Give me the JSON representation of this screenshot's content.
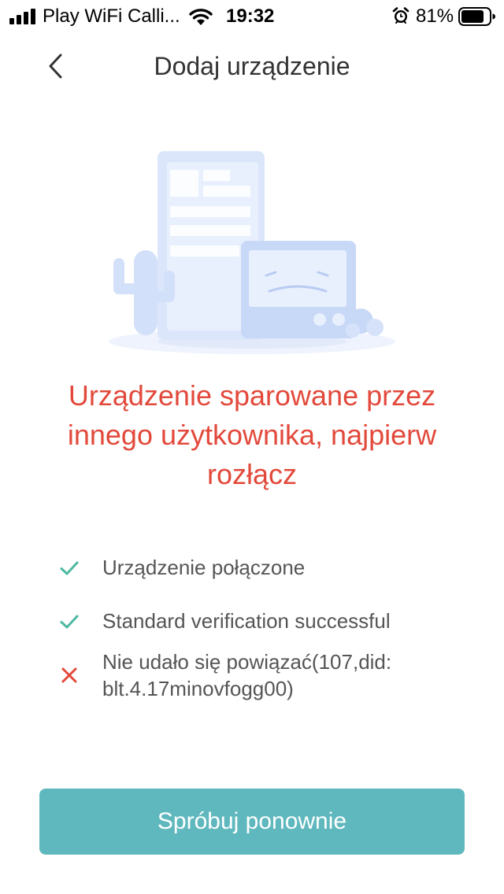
{
  "status_bar": {
    "carrier": "Play WiFi Calli...",
    "time": "19:32",
    "battery": "81%",
    "icons": [
      "signal-icon",
      "wifi-icon",
      "alarm-icon",
      "battery-icon"
    ]
  },
  "header": {
    "title": "Dodaj urządzenie",
    "back_icon": "chevron-left-icon"
  },
  "main": {
    "illustration": "device-disconnected-illustration",
    "error_message": "Urządzenie sparowane przez innego użytkownika, najpierw rozłącz",
    "steps": [
      {
        "status": "success",
        "icon": "check-icon",
        "text": "Urządzenie połączone"
      },
      {
        "status": "success",
        "icon": "check-icon",
        "text": "Standard verification successful"
      },
      {
        "status": "error",
        "icon": "cross-icon",
        "text": "Nie udało się powiązać(107,did: blt.4.17minovfogg00)"
      }
    ],
    "retry_label": "Spróbuj ponownie"
  },
  "colors": {
    "error": "#e2493b",
    "success": "#4cb9a0",
    "button": "#5fb8be",
    "illustration": "#dbe6fb"
  }
}
